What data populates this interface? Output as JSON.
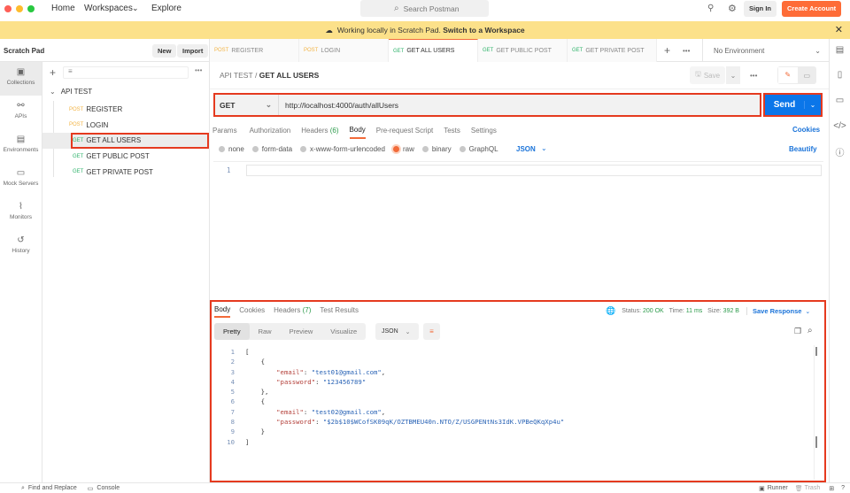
{
  "topbar": {
    "nav": [
      "Home",
      "Workspaces",
      "Explore"
    ],
    "search_placeholder": "Search Postman",
    "sign_in": "Sign In",
    "create_account": "Create Account"
  },
  "banner": {
    "text": "Working locally in Scratch Pad.",
    "link": "Switch to a Workspace"
  },
  "sidebar": {
    "title": "Scratch Pad",
    "new": "New",
    "import": "Import",
    "nav": [
      "Collections",
      "APIs",
      "Environments",
      "Mock Servers",
      "Monitors",
      "History"
    ],
    "collection": "API TEST",
    "items": [
      {
        "method": "POST",
        "name": "REGISTER"
      },
      {
        "method": "POST",
        "name": "LOGIN"
      },
      {
        "method": "GET",
        "name": "GET ALL USERS"
      },
      {
        "method": "GET",
        "name": "GET PUBLIC POST"
      },
      {
        "method": "GET",
        "name": "GET PRIVATE POST"
      }
    ]
  },
  "tabs": [
    {
      "method": "POST",
      "name": "REGISTER"
    },
    {
      "method": "POST",
      "name": "LOGIN"
    },
    {
      "method": "GET",
      "name": "GET ALL USERS"
    },
    {
      "method": "GET",
      "name": "GET PUBLIC POST"
    },
    {
      "method": "GET",
      "name": "GET PRIVATE POST"
    }
  ],
  "environment": "No Environment",
  "request": {
    "breadcrumb_parent": "API TEST",
    "breadcrumb_sep": "/",
    "breadcrumb_current": "GET ALL USERS",
    "save": "Save",
    "method": "GET",
    "url": "http://localhost:4000/auth/allUsers",
    "send": "Send",
    "tabs": [
      "Params",
      "Authorization",
      "Headers",
      "Body",
      "Pre-request Script",
      "Tests",
      "Settings"
    ],
    "headers_count": "(6)",
    "cookies": "Cookies",
    "body_types": [
      "none",
      "form-data",
      "x-www-form-urlencoded",
      "raw",
      "binary",
      "GraphQL"
    ],
    "format": "JSON",
    "beautify": "Beautify",
    "editor_line": "1"
  },
  "response": {
    "tabs": [
      "Body",
      "Cookies",
      "Headers",
      "Test Results"
    ],
    "headers_count": "(7)",
    "status_label": "Status:",
    "status": "200 OK",
    "time_label": "Time:",
    "time": "11 ms",
    "size_label": "Size:",
    "size": "392 B",
    "save_response": "Save Response",
    "views": [
      "Pretty",
      "Raw",
      "Preview",
      "Visualize"
    ],
    "format": "JSON",
    "lines": [
      {
        "n": "1",
        "indent": "",
        "parts": [
          {
            "t": "[",
            "c": "p"
          }
        ]
      },
      {
        "n": "2",
        "indent": "    ",
        "parts": [
          {
            "t": "{",
            "c": "p"
          }
        ]
      },
      {
        "n": "3",
        "indent": "        ",
        "parts": [
          {
            "t": "\"email\"",
            "c": "key"
          },
          {
            "t": ": ",
            "c": "p"
          },
          {
            "t": "\"test01@gmail.com\"",
            "c": "str"
          },
          {
            "t": ",",
            "c": "p"
          }
        ]
      },
      {
        "n": "4",
        "indent": "        ",
        "parts": [
          {
            "t": "\"password\"",
            "c": "key"
          },
          {
            "t": ": ",
            "c": "p"
          },
          {
            "t": "\"123456789\"",
            "c": "str"
          }
        ]
      },
      {
        "n": "5",
        "indent": "    ",
        "parts": [
          {
            "t": "},",
            "c": "p"
          }
        ]
      },
      {
        "n": "6",
        "indent": "    ",
        "parts": [
          {
            "t": "{",
            "c": "p"
          }
        ]
      },
      {
        "n": "7",
        "indent": "        ",
        "parts": [
          {
            "t": "\"email\"",
            "c": "key"
          },
          {
            "t": ": ",
            "c": "p"
          },
          {
            "t": "\"test02@gmail.com\"",
            "c": "str"
          },
          {
            "t": ",",
            "c": "p"
          }
        ]
      },
      {
        "n": "8",
        "indent": "        ",
        "parts": [
          {
            "t": "\"password\"",
            "c": "key"
          },
          {
            "t": ": ",
            "c": "p"
          },
          {
            "t": "\"$2b$10$WCofSK09qK/OZTBMEU40n.NTO/Z/USGPENtNs3IdK.VPBeQKqXp4u\"",
            "c": "str"
          }
        ]
      },
      {
        "n": "9",
        "indent": "    ",
        "parts": [
          {
            "t": "}",
            "c": "p"
          }
        ]
      },
      {
        "n": "10",
        "indent": "",
        "parts": [
          {
            "t": "]",
            "c": "p"
          }
        ]
      }
    ]
  },
  "statusbar": {
    "find_replace": "Find and Replace",
    "console": "Console",
    "runner": "Runner",
    "trash": "Trash"
  }
}
